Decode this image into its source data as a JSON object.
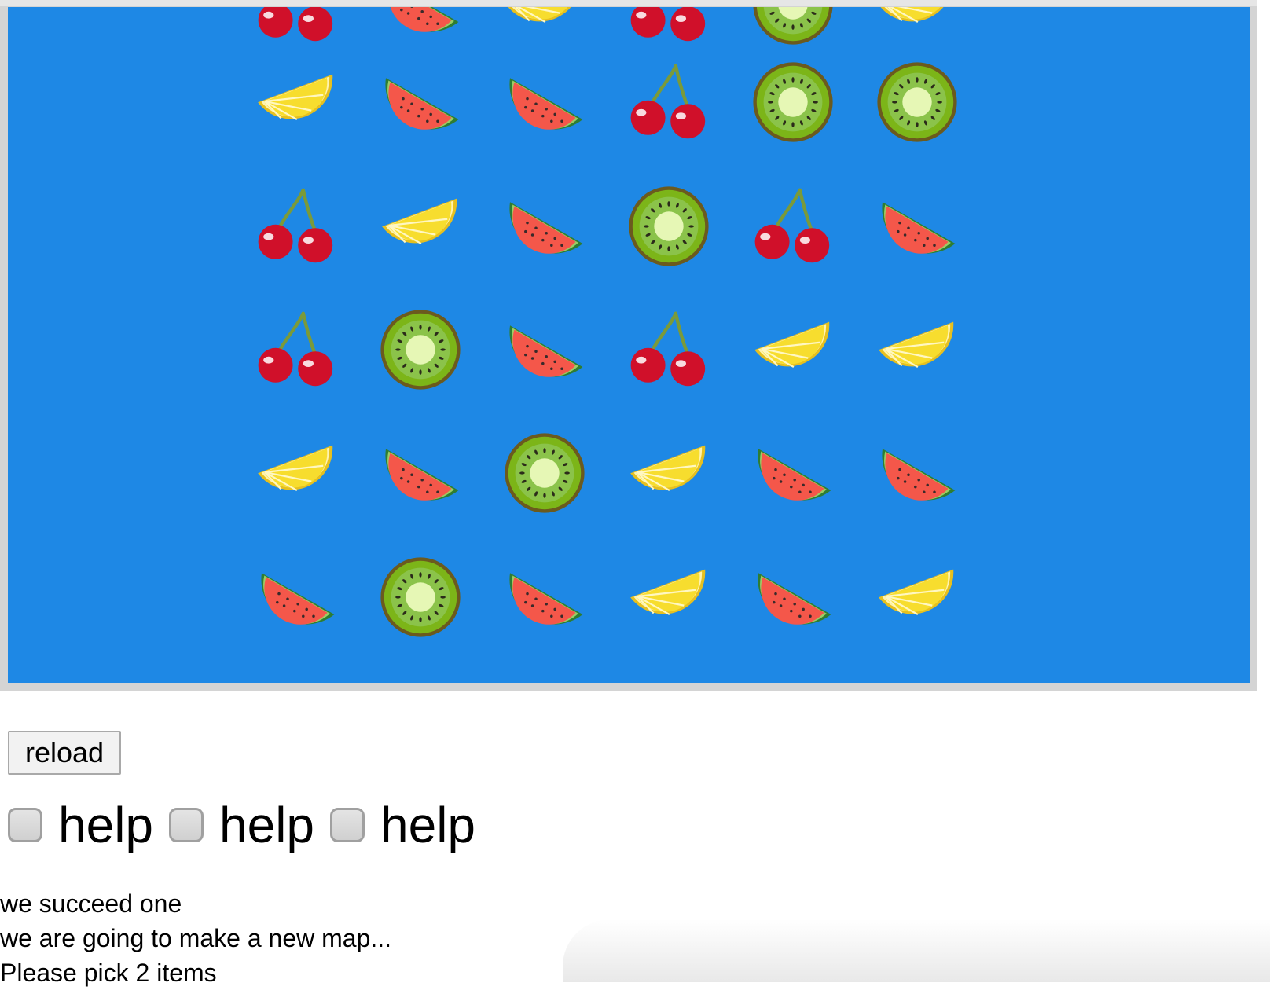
{
  "game": {
    "board_color": "#1e88e5",
    "grid": {
      "rows": [
        [
          "cherry",
          "watermelon",
          "lemon",
          "cherry",
          "kiwi",
          "lemon"
        ],
        [
          "lemon",
          "watermelon",
          "watermelon",
          "cherry",
          "kiwi",
          "kiwi"
        ],
        [
          "cherry",
          "lemon",
          "watermelon",
          "kiwi",
          "cherry",
          "watermelon"
        ],
        [
          "cherry",
          "kiwi",
          "watermelon",
          "cherry",
          "lemon",
          "lemon"
        ],
        [
          "lemon",
          "watermelon",
          "kiwi",
          "lemon",
          "watermelon",
          "watermelon"
        ],
        [
          "watermelon",
          "kiwi",
          "watermelon",
          "lemon",
          "watermelon",
          "lemon"
        ]
      ]
    }
  },
  "controls": {
    "reload_label": "reload",
    "help_options": [
      {
        "label": "help",
        "checked": false
      },
      {
        "label": "help",
        "checked": false
      },
      {
        "label": "help",
        "checked": false
      }
    ]
  },
  "messages": [
    "we succeed one",
    "we are going to make a new map...",
    "Please pick 2 items"
  ]
}
